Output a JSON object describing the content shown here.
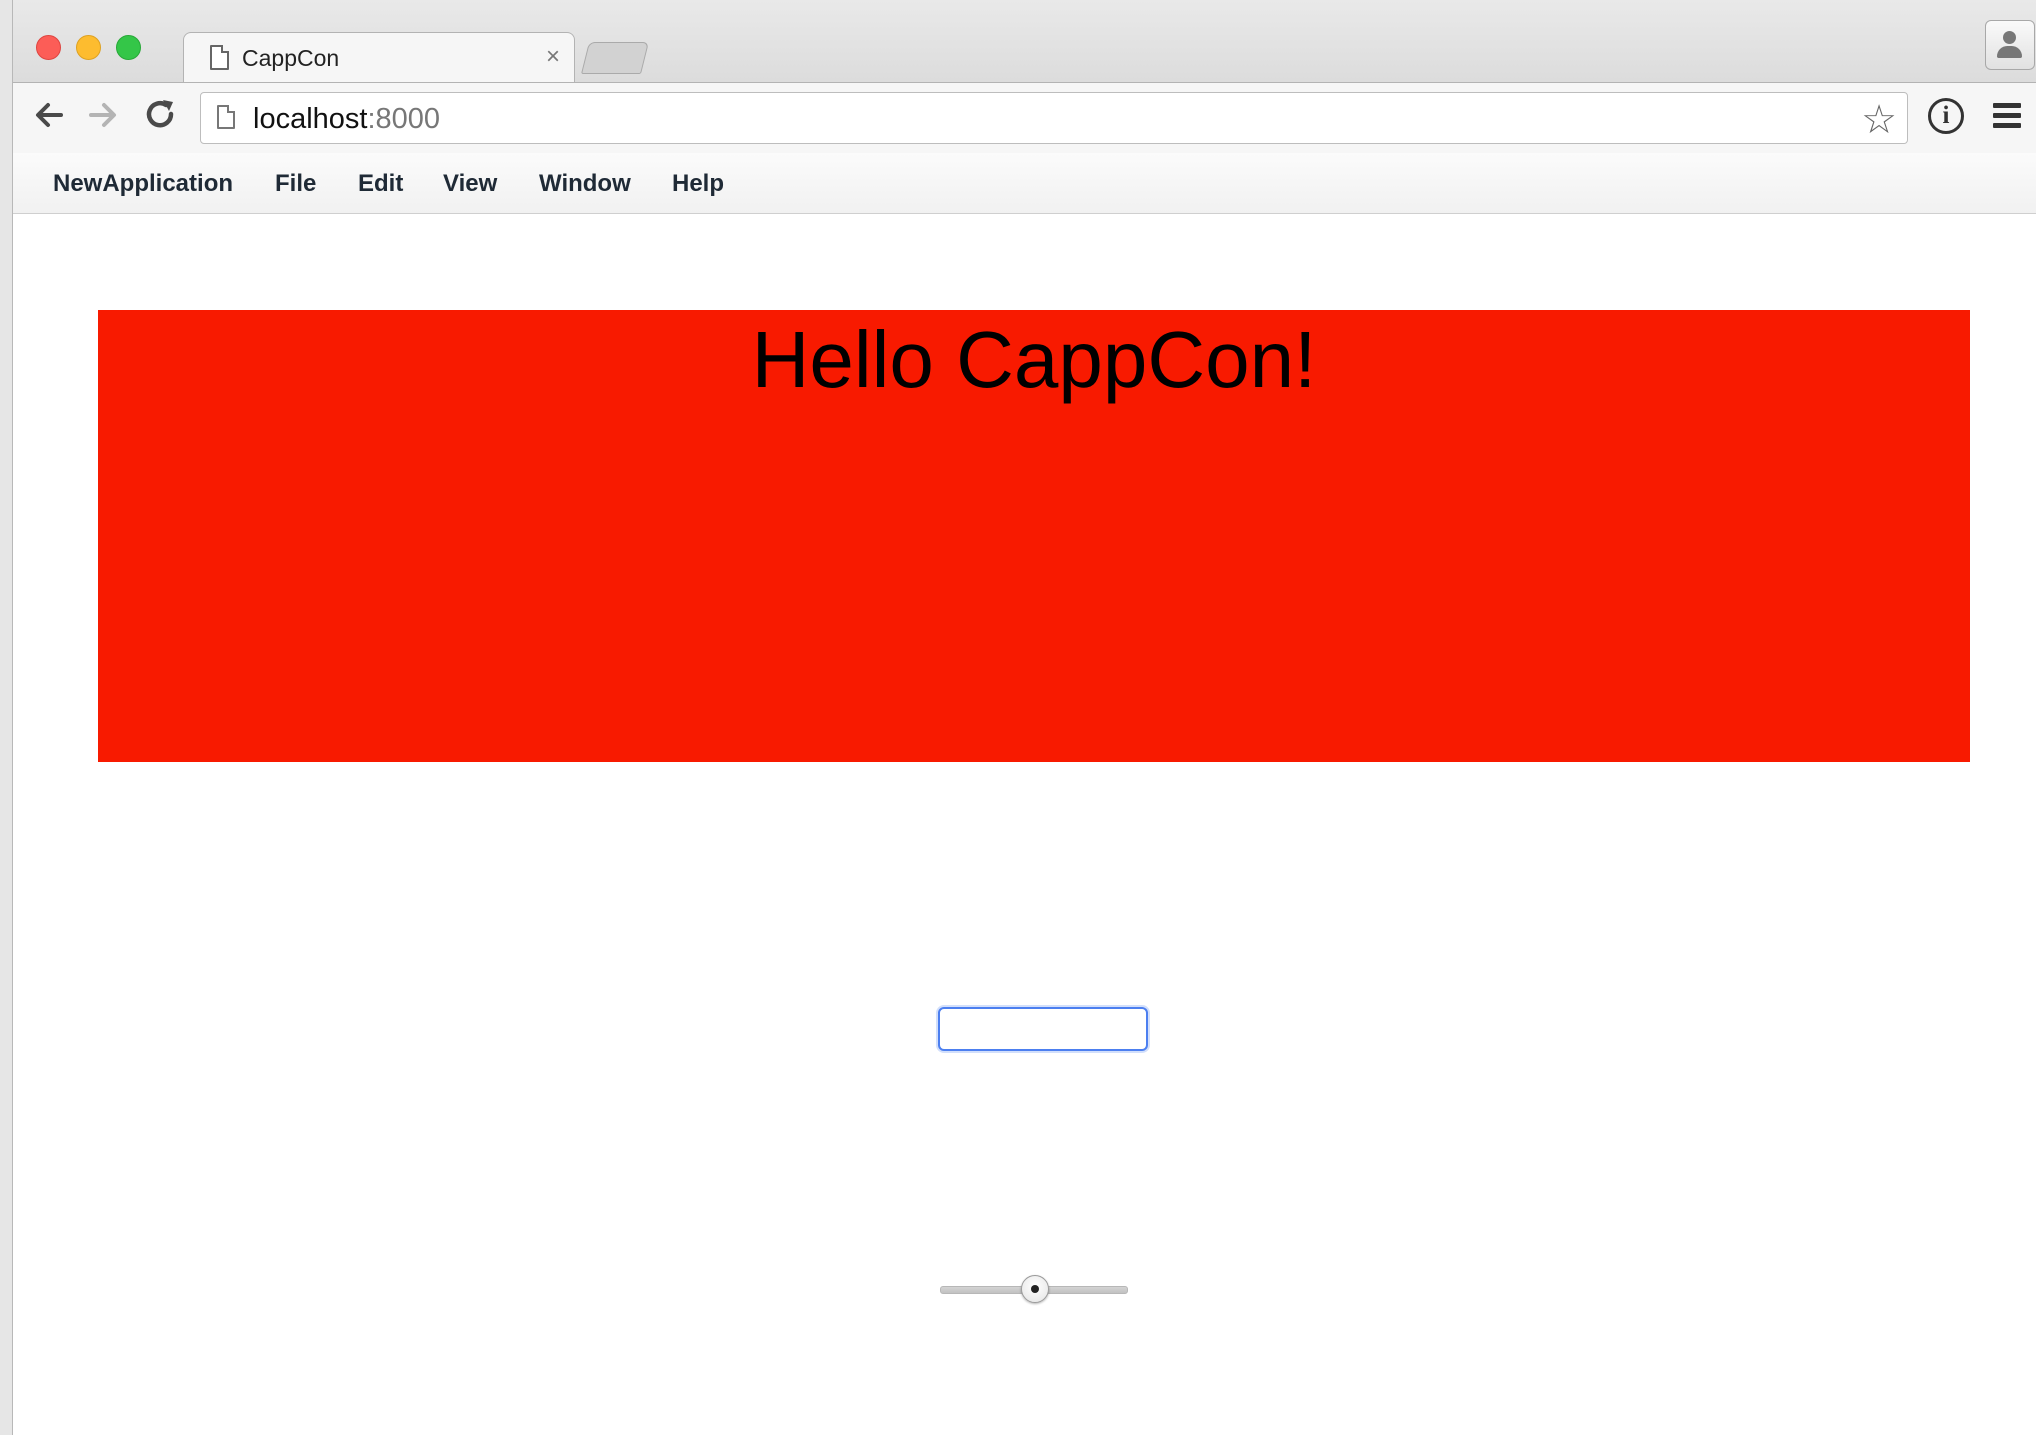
{
  "browser": {
    "tab": {
      "title": "CappCon",
      "close_glyph": "×"
    },
    "address": {
      "host": "localhost",
      "port": ":8000"
    },
    "icons": {
      "back": "arrow-left-icon",
      "forward": "arrow-right-icon",
      "reload": "reload-icon",
      "bookmark": "star-icon",
      "info": "info-icon",
      "menu": "hamburger-menu-icon",
      "profile": "profile-icon"
    }
  },
  "app_menu": {
    "items": [
      "NewApplication",
      "File",
      "Edit",
      "View",
      "Window",
      "Help"
    ]
  },
  "page": {
    "banner": {
      "text": "Hello CappCon!",
      "color": "#f81a00"
    },
    "text_field": {
      "value": ""
    },
    "slider": {
      "value": 0.5
    }
  }
}
